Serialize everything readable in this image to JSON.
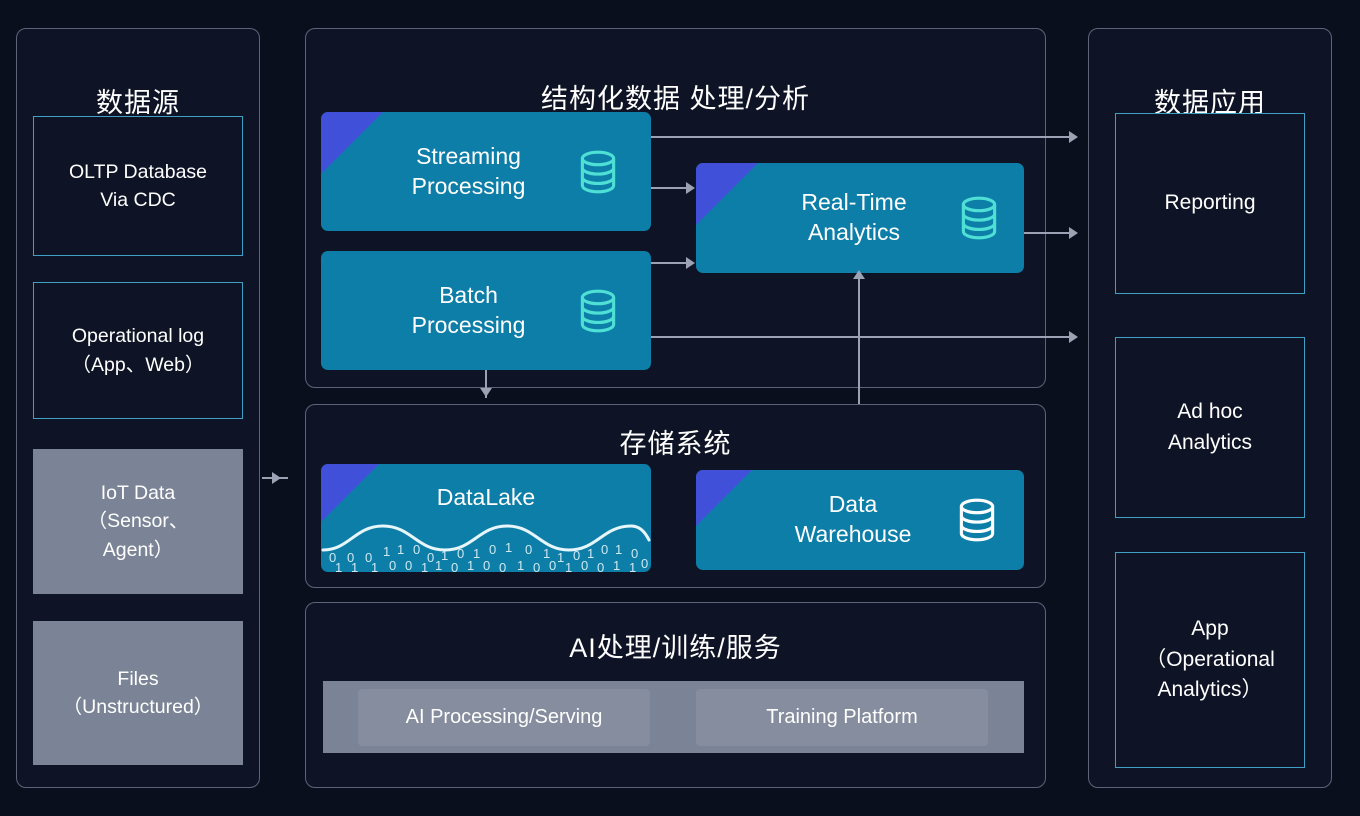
{
  "diagram": {
    "background_color": "#0a0f1e",
    "accent_teal": "#0d7ea8",
    "accent_blue": "#4050d8",
    "outline_cyan": "#3f9fc4",
    "grey_box": "#7b8496",
    "connector_color": "#9aa2b4"
  },
  "sources_panel": {
    "title": "数据源",
    "items": [
      {
        "label": "OLTP Database\nVia CDC",
        "style": "outline"
      },
      {
        "label": "Operational log\n（App、Web）",
        "style": "outline"
      },
      {
        "label": "IoT Data\n（Sensor、\nAgent）",
        "style": "solid"
      },
      {
        "label": "Files\n（Unstructured）",
        "style": "solid"
      }
    ]
  },
  "processing_panel": {
    "title": "结构化数据 处理/分析",
    "cards": [
      {
        "label": "Streaming\nProcessing",
        "corner": true,
        "icon": "database-icon",
        "icon_color": "#4fe0d5"
      },
      {
        "label": "Batch\nProcessing",
        "corner": false,
        "icon": "database-icon",
        "icon_color": "#4fe0d5"
      },
      {
        "label": "Real-Time\nAnalytics",
        "corner": true,
        "icon": "database-icon",
        "icon_color": "#4fe0d5"
      }
    ]
  },
  "storage_panel": {
    "title": "存储系统",
    "cards": [
      {
        "label": "DataLake",
        "corner": true,
        "icon": "binary-wave-icon"
      },
      {
        "label": "Data\nWarehouse",
        "corner": true,
        "icon": "database-icon",
        "icon_color": "#ffffff"
      }
    ]
  },
  "ai_panel": {
    "title": "AI处理/训练/服务",
    "chips": [
      {
        "label": "AI Processing/Serving"
      },
      {
        "label": "Training Platform"
      }
    ]
  },
  "apps_panel": {
    "title": "数据应用",
    "items": [
      {
        "label": "Reporting"
      },
      {
        "label": "Ad hoc\nAnalytics"
      },
      {
        "label": "App\n（Operational\nAnalytics）"
      }
    ]
  }
}
